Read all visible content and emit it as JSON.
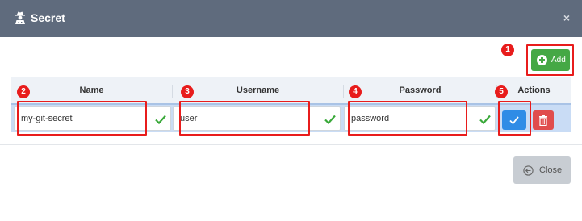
{
  "dialog": {
    "title": "Secret",
    "title_icon": "user-secret-icon",
    "close_icon": "close-icon",
    "close_glyph": "×"
  },
  "toolbar": {
    "add_label": "Add",
    "add_icon": "plus-circle-icon"
  },
  "table": {
    "headers": [
      "Name",
      "Username",
      "Password",
      "Actions"
    ],
    "rows": [
      {
        "name": "my-git-secret",
        "username": "user",
        "password": "password"
      }
    ]
  },
  "annotations": [
    "1",
    "2",
    "3",
    "4",
    "5"
  ],
  "footer": {
    "close_label": "Close",
    "close_icon": "circle-arrow-left-icon"
  },
  "colors": {
    "header_bg": "#5f6b7d",
    "add_button": "#45a845",
    "confirm_button": "#2f8ce6",
    "delete_button": "#e04d4d",
    "callout": "#e81c1c",
    "row_highlight": "#c9dcf5"
  }
}
